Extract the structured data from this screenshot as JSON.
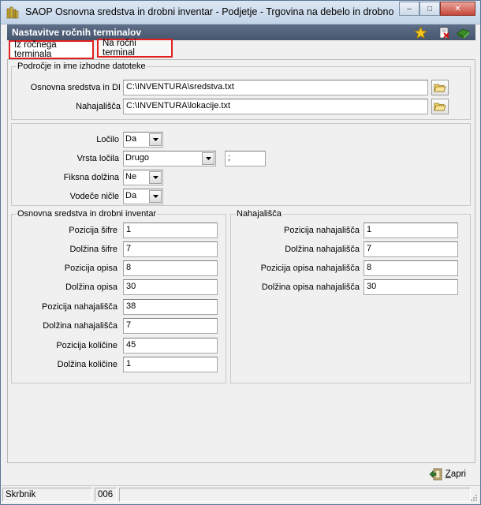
{
  "window": {
    "title": "SAOP  Osnovna sredstva in drobni inventar  - Podjetje - Trgovina na debelo in drobno",
    "app_icon": "books-icon",
    "controls": {
      "minimize": "–",
      "maximize": "□",
      "close": "✕"
    }
  },
  "form": {
    "title": "Nastavitve ročnih terminalov",
    "header_icons": [
      "star-icon",
      "delete-page-icon",
      "book-icon"
    ]
  },
  "tabs": [
    {
      "label": "Iz ročnega terminala",
      "active": true
    },
    {
      "label": "Na ročni terminal",
      "active": false
    }
  ],
  "source_file": {
    "legend": "Področje in ime izhodne datoteke",
    "fixed_assets_label": "Osnovna sredstva in DI",
    "fixed_assets_value": "C:\\INVENTURA\\sredstva.txt",
    "locations_label": "Nahajališča",
    "locations_value": "C:\\INVENTURA\\lokacije.txt"
  },
  "format": {
    "separator_label": "Ločilo",
    "separator_value": "Da",
    "separator_type_label": "Vrsta ločila",
    "separator_type_value": "Drugo",
    "separator_char": ";",
    "fixed_length_label": "Fiksna dolžina",
    "fixed_length_value": "Ne",
    "leading_zeros_label": "Vodeče ničle",
    "leading_zeros_value": "Da"
  },
  "assets_group": {
    "legend": "Osnovna sredstva in drobni inventar",
    "fields": [
      {
        "label": "Pozicija šifre",
        "value": "1"
      },
      {
        "label": "Dolžina šifre",
        "value": "7"
      },
      {
        "label": "Pozicija opisa",
        "value": "8"
      },
      {
        "label": "Dolžina opisa",
        "value": "30"
      },
      {
        "label": "Pozicija nahajališča",
        "value": "38"
      },
      {
        "label": "Dolžina nahajališča",
        "value": "7"
      },
      {
        "label": "Pozicija količine",
        "value": "45"
      },
      {
        "label": "Dolžina količine",
        "value": "1"
      }
    ]
  },
  "locations_group": {
    "legend": "Nahajališča",
    "fields": [
      {
        "label": "Pozicija nahajališča",
        "value": "1"
      },
      {
        "label": "Dolžina nahajališča",
        "value": "7"
      },
      {
        "label": "Pozicija opisa nahajališča",
        "value": "8"
      },
      {
        "label": "Dolžina opisa nahajališča",
        "value": "30"
      }
    ]
  },
  "footer": {
    "close_label": "Zapri",
    "close_mnemonic": "Z",
    "close_rest": "apri"
  },
  "statusbar": {
    "user": "Skrbnik",
    "code": "006"
  }
}
